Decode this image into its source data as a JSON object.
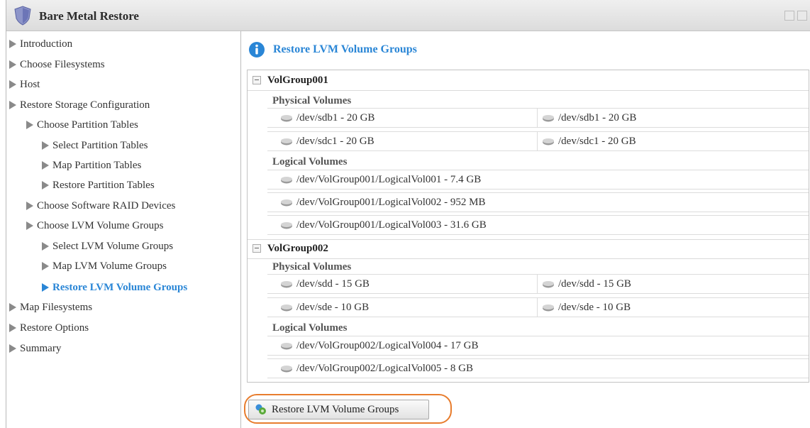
{
  "window": {
    "title": "Bare Metal Restore"
  },
  "sidebar": {
    "items": [
      {
        "label": "Introduction"
      },
      {
        "label": "Choose Filesystems"
      },
      {
        "label": "Host"
      },
      {
        "label": "Restore Storage Configuration"
      },
      {
        "label": "Choose Partition Tables"
      },
      {
        "label": "Select Partition Tables"
      },
      {
        "label": "Map Partition Tables"
      },
      {
        "label": "Restore Partition Tables"
      },
      {
        "label": "Choose Software RAID Devices"
      },
      {
        "label": "Choose LVM Volume Groups"
      },
      {
        "label": "Select LVM Volume Groups"
      },
      {
        "label": "Map LVM Volume Groups"
      },
      {
        "label": "Restore LVM Volume Groups",
        "active": true
      },
      {
        "label": "Map Filesystems"
      },
      {
        "label": "Restore Options"
      },
      {
        "label": "Summary"
      }
    ]
  },
  "main": {
    "title": "Restore LVM Volume Groups",
    "groups": [
      {
        "name": "VolGroup001",
        "physical_label": "Physical Volumes",
        "physical": [
          {
            "source": "/dev/sdb1 - 20 GB",
            "target": "/dev/sdb1 - 20 GB"
          },
          {
            "source": "/dev/sdc1 - 20 GB",
            "target": "/dev/sdc1 - 20 GB"
          }
        ],
        "logical_label": "Logical Volumes",
        "logical": [
          "/dev/VolGroup001/LogicalVol001 - 7.4 GB",
          "/dev/VolGroup001/LogicalVol002 - 952 MB",
          "/dev/VolGroup001/LogicalVol003 - 31.6 GB"
        ]
      },
      {
        "name": "VolGroup002",
        "physical_label": "Physical Volumes",
        "physical": [
          {
            "source": "/dev/sdd - 15 GB",
            "target": "/dev/sdd - 15 GB"
          },
          {
            "source": "/dev/sde - 10 GB",
            "target": "/dev/sde - 10 GB"
          }
        ],
        "logical_label": "Logical Volumes",
        "logical": [
          "/dev/VolGroup002/LogicalVol004 - 17 GB",
          "/dev/VolGroup002/LogicalVol005 - 8 GB"
        ]
      }
    ],
    "restore_button": "Restore LVM Volume Groups"
  },
  "colors": {
    "accent": "#2a86d6",
    "highlight": "#e87d2e"
  },
  "icons": [
    "shield-icon",
    "info-icon",
    "disk-icon",
    "restore-icon",
    "collapse-icon",
    "expand-arrow-icon"
  ]
}
